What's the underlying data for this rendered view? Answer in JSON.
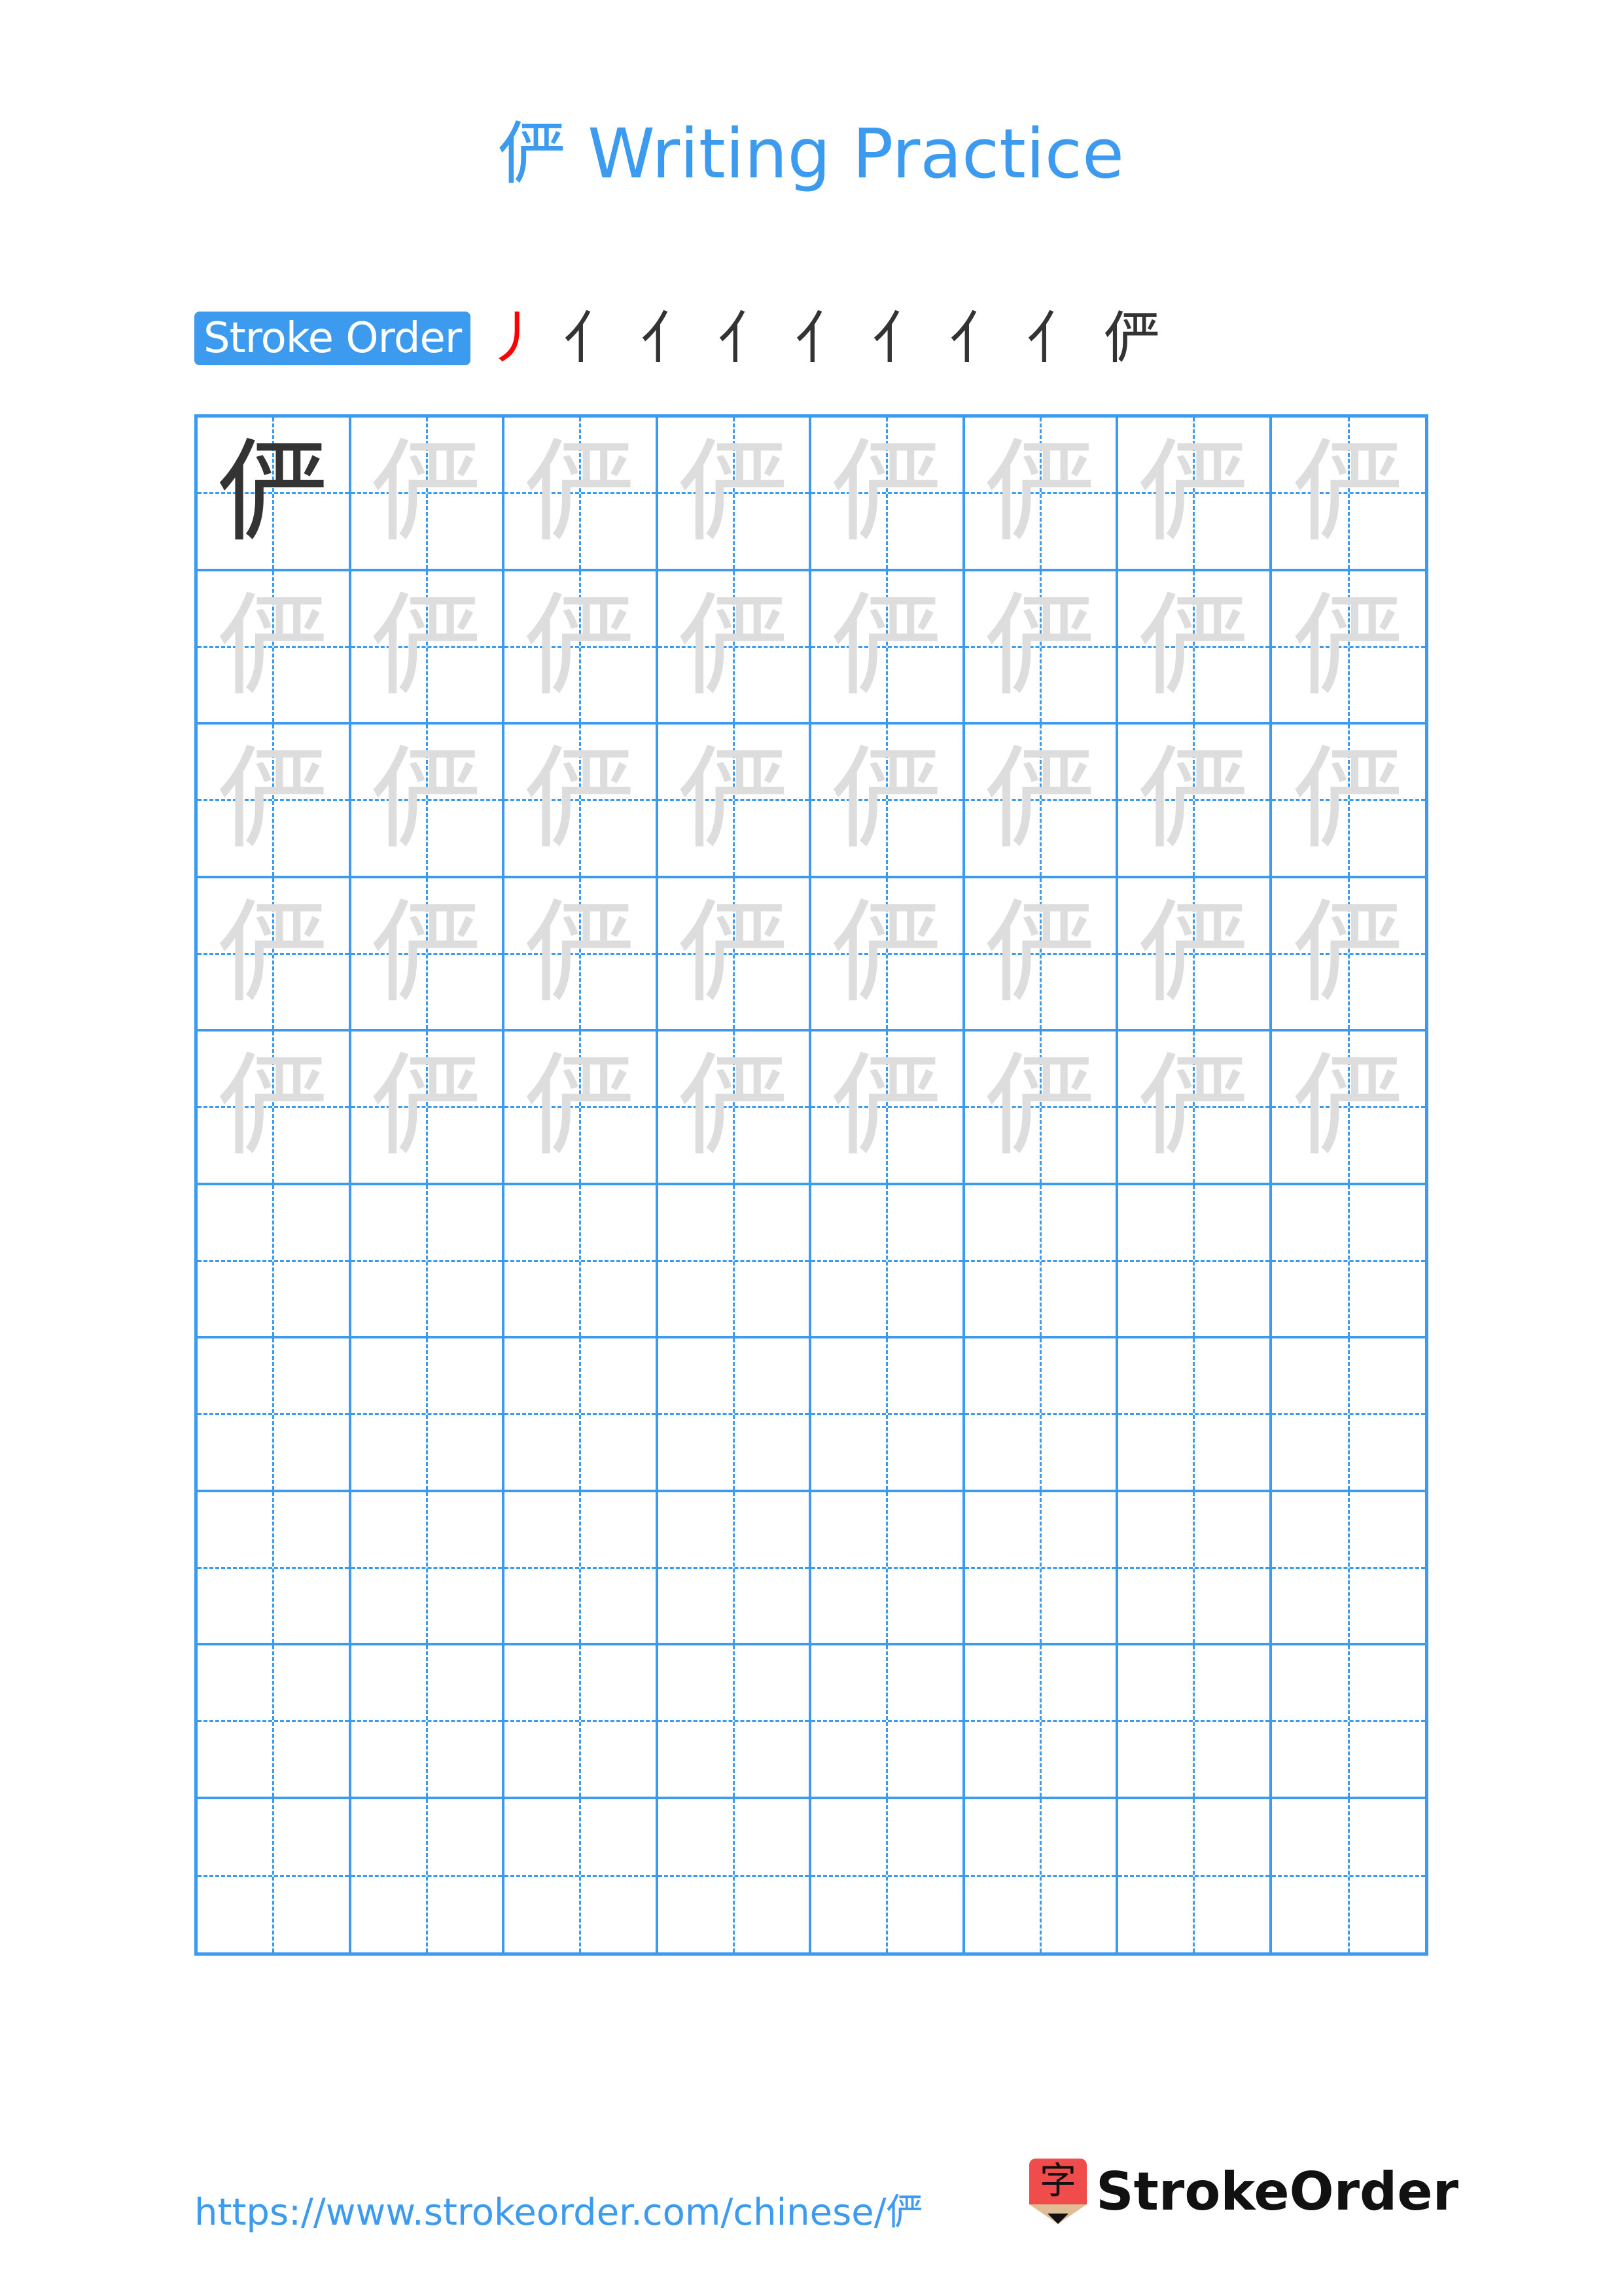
{
  "character": "俨",
  "header": {
    "title": "俨 Writing Practice"
  },
  "stroke_order": {
    "label": "Stroke Order",
    "steps": [
      "丿",
      "亻",
      "亻",
      "亻",
      "亻",
      "亻",
      "亻",
      "亻",
      "俨"
    ],
    "total_strokes": 9,
    "highlight_color": "#ff0000",
    "stroke_color": "#333333"
  },
  "grid": {
    "columns": 8,
    "rows": 10,
    "model_rows": 1,
    "trace_rows": 4,
    "blank_rows": 5,
    "line_color": "#3d9bef",
    "model_color": "#333333",
    "trace_color": "#dddddd"
  },
  "footer": {
    "url": "https://www.strokeorder.com/chinese/俨",
    "logo_glyph": "字",
    "brand": "StrokeOrder",
    "brand_color_icon": "#f04c4c"
  }
}
